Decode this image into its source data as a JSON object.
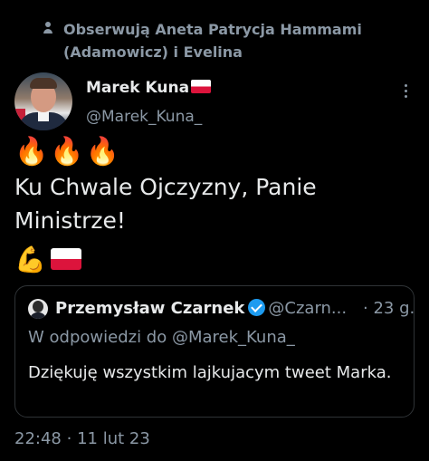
{
  "social_context": "Obserwują Aneta Patrycja Hammami (Adamowicz) i Evelina",
  "author": {
    "name": "Marek Kuna",
    "handle": "@Marek_Kuna_"
  },
  "tweet": {
    "fire_emojis": "🔥🔥🔥",
    "text": "Ku Chwale Ojczyzny, Panie Ministrze!",
    "bicep_emoji": "💪"
  },
  "quoted": {
    "name": "Przemysław Czarnek",
    "handle": "@Czarn...",
    "time_sep": "·",
    "time": "23 g.",
    "reply_to": "W odpowiedzi do @Marek_Kuna_",
    "text": "Dziękuję wszystkim lajkujacym tweet Marka."
  },
  "footer": {
    "time": "22:48",
    "sep": "·",
    "date": "11 lut 23"
  },
  "colors": {
    "background": "#000000",
    "text": "#e7e9ea",
    "muted": "#8b98a5",
    "verified": "#1d9bf0",
    "border": "#2f3336"
  }
}
